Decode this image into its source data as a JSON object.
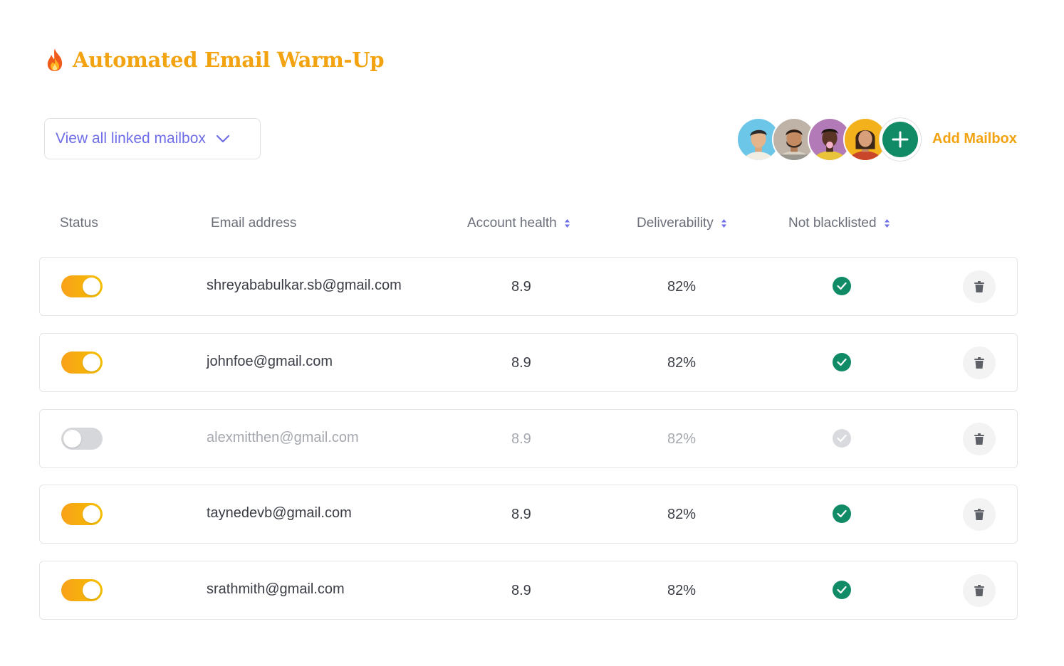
{
  "header": {
    "title": "Automated Email Warm-Up",
    "title_icon": "flame-icon"
  },
  "filter": {
    "label": "View all linked mailbox",
    "icon": "chevron-down-icon"
  },
  "mailbox_actions": {
    "add_label": "Add Mailbox",
    "avatar_count": 4,
    "add_icon": "plus-icon"
  },
  "table": {
    "columns": {
      "status": "Status",
      "email": "Email address",
      "health": "Account health",
      "deliverability": "Deliverability",
      "blacklist": "Not blacklisted"
    },
    "rows": [
      {
        "enabled": true,
        "email": "shreyababulkar.sb@gmail.com",
        "health": "8.9",
        "deliverability": "82%",
        "not_blacklisted": true
      },
      {
        "enabled": true,
        "email": "johnfoe@gmail.com",
        "health": "8.9",
        "deliverability": "82%",
        "not_blacklisted": true
      },
      {
        "enabled": false,
        "email": "alexmitthen@gmail.com",
        "health": "8.9",
        "deliverability": "82%",
        "not_blacklisted": true
      },
      {
        "enabled": true,
        "email": "taynedevb@gmail.com",
        "health": "8.9",
        "deliverability": "82%",
        "not_blacklisted": true
      },
      {
        "enabled": true,
        "email": "srathmith@gmail.com",
        "health": "8.9",
        "deliverability": "82%",
        "not_blacklisted": true
      }
    ]
  },
  "colors": {
    "accent": "#f2a30f",
    "primary": "#6f6de8",
    "success": "#118a66",
    "toggle_on_start": "#f8a01a",
    "toggle_on_end": "#f5c000",
    "toggle_off": "#d6d7da"
  }
}
